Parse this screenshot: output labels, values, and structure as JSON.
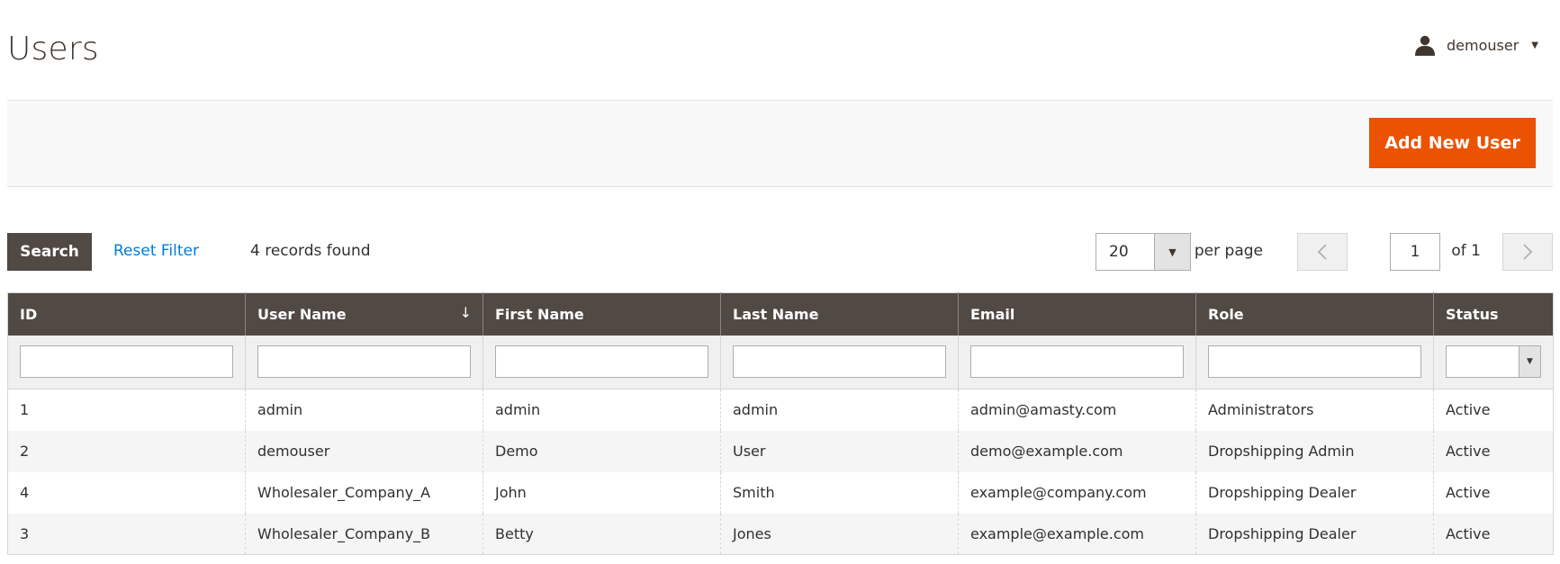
{
  "header": {
    "title": "Users",
    "account": {
      "username": "demouser",
      "user_icon": "user-icon",
      "caret_icon": "caret-down-icon"
    }
  },
  "actions": {
    "add_button": "Add New User",
    "add_button_color": "#eb5202"
  },
  "grid_controls": {
    "search_button": "Search",
    "reset_filter": "Reset Filter",
    "records_found": "4 records found",
    "per_page_value": "20",
    "per_page_label": "per page",
    "current_page": "1",
    "of_pages": "of 1"
  },
  "table": {
    "columns": [
      "ID",
      "User Name",
      "First Name",
      "Last Name",
      "Email",
      "Role",
      "Status"
    ],
    "sort_indicator": "↓",
    "rows": [
      [
        "1",
        "admin",
        "admin",
        "admin",
        "admin@amasty.com",
        "Administrators",
        "Active"
      ],
      [
        "2",
        "demouser",
        "Demo",
        "User",
        "demo@example.com",
        "Dropshipping Admin",
        "Active"
      ],
      [
        "4",
        "Wholesaler_Company_A",
        "John",
        "Smith",
        "example@company.com",
        "Dropshipping Dealer",
        "Active"
      ],
      [
        "3",
        "Wholesaler_Company_B",
        "Betty",
        "Jones",
        "example@example.com",
        "Dropshipping Dealer",
        "Active"
      ]
    ]
  },
  "colors": {
    "header_bg": "#514943",
    "link": "#007bdb",
    "accent": "#eb5202"
  }
}
